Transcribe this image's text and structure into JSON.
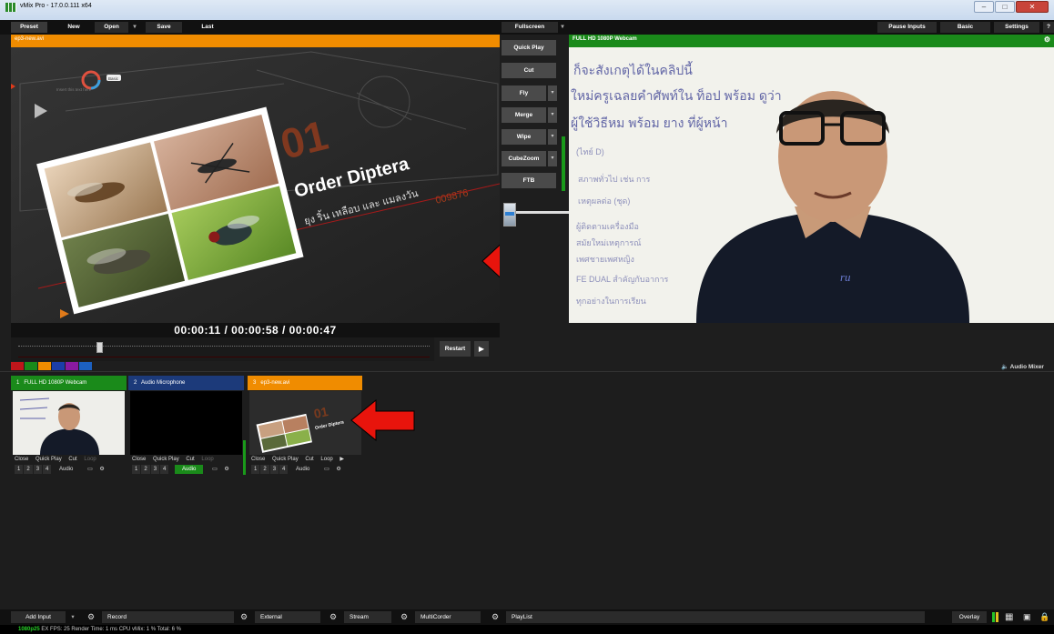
{
  "window": {
    "title": "vMix Pro - 17.0.0.111 x64",
    "controls": [
      "–",
      "□",
      "✕"
    ]
  },
  "menubar": {
    "preset": "Preset",
    "new": "New",
    "open": "Open",
    "open_dropdown": "▾",
    "save": "Save",
    "last": "Last",
    "fullscreen": "Fullscreen",
    "fullscreen_dropdown": "▾",
    "pause_inputs": "Pause Inputs",
    "basic": "Basic",
    "settings": "Settings",
    "help": "?"
  },
  "preview": {
    "title": "ep3-new.avi",
    "overlay_number": "01",
    "overlay_title": "Order Diptera",
    "overlay_subtitle": "ยุง ริ้น เหลือบ และ แมลงวัน",
    "overlay_code": "009876",
    "small_label": "Basic",
    "bg_text": "Insert this text here",
    "timecode": "00:00:11 / 00:00:58 / 00:00:47",
    "position_fraction": 0.19,
    "restart_label": "Restart",
    "play_icon": "▶",
    "color_swatches": [
      "#c0161b",
      "#1a8a1a",
      "#f08c00",
      "#1c3ea8",
      "#8a1aa0",
      "#1c60c0"
    ]
  },
  "transitions": {
    "quick_play": "Quick Play",
    "cut": "Cut",
    "fly": "Fly",
    "merge": "Merge",
    "wipe": "Wipe",
    "cubezoom": "CubeZoom",
    "ftb": "FTB",
    "dropdown": "▾"
  },
  "output": {
    "title": "FULL HD 1080P Webcam",
    "gear_icon": "⚙",
    "whiteboard_lines": [
      "ก็จะสังเกตุได้ในคลิปนี้",
      "ใหม่ครูเฉลยคำศัพท์ใน ท็อป พร้อม ดูว่า",
      "ผู้ใช้วิธีหม พร้อม ยาง ที่ผู้หน้า",
      "(ไทย์ D)",
      "สภาพทั่วไป เช่น การ",
      "เหตุผลต่อ (ชุด)",
      "ผู้ติดตามเครื่องมือ",
      "สมัยใหม่เหตุการณ์",
      "เพศชายเพศหญิง",
      "FE DUAL สำคัญกับอาการ",
      "ทุกอย่างในการเรียน"
    ],
    "shirt_logo": "ru"
  },
  "audio_mixer": {
    "icon": "🔈",
    "label": "Audio Mixer"
  },
  "inputs": [
    {
      "number": "1",
      "name": "FULL HD 1080P Webcam",
      "header_color": "#1a8a1a",
      "controls": [
        "Close",
        "Quick Play",
        "Cut",
        "Loop"
      ],
      "loop_enabled": false,
      "overlays": [
        "1",
        "2",
        "3",
        "4"
      ],
      "audio_label": "Audio",
      "audio_on": false
    },
    {
      "number": "2",
      "name": "Audio Microphone",
      "header_color": "#1c3a7a",
      "controls": [
        "Close",
        "Quick Play",
        "Cut",
        "Loop"
      ],
      "loop_enabled": false,
      "overlays": [
        "1",
        "2",
        "3",
        "4"
      ],
      "audio_label": "Audio",
      "audio_on": true
    },
    {
      "number": "3",
      "name": "ep3-new.avi",
      "header_color": "#f08c00",
      "controls": [
        "Close",
        "Quick Play",
        "Cut",
        "Loop"
      ],
      "loop_enabled": true,
      "overlays": [
        "1",
        "2",
        "3",
        "4"
      ],
      "audio_label": "Audio",
      "audio_on": false,
      "thumb_title": "Order Diptera"
    }
  ],
  "bottom_bar": {
    "add_input": "Add Input",
    "add_input_dropdown": "▾",
    "record": "Record",
    "external": "External",
    "stream": "Stream",
    "multicorder": "MultiCorder",
    "playlist": "PlayList",
    "overlay": "Overlay",
    "gear_icon": "⚙"
  },
  "status": {
    "format": "1080p25",
    "text": "EX  FPS: 25  Render Time: 1 ms  CPU vMix: 1 %  Total: 6 %"
  }
}
